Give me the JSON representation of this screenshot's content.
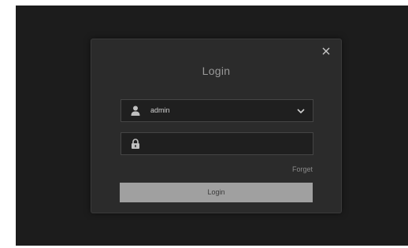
{
  "dialog": {
    "title": "Login",
    "close_icon": "close-icon"
  },
  "username_field": {
    "icon": "user-icon",
    "value": "admin",
    "dropdown_icon": "chevron-down-icon"
  },
  "password_field": {
    "icon": "lock-icon",
    "value": "",
    "placeholder": ""
  },
  "links": {
    "forget": "Forget"
  },
  "buttons": {
    "login": "Login"
  },
  "colors": {
    "background": "#1c1c1c",
    "dialog": "#2b2b2b",
    "field": "#1f1f1f",
    "button": "#a0a0a0"
  }
}
